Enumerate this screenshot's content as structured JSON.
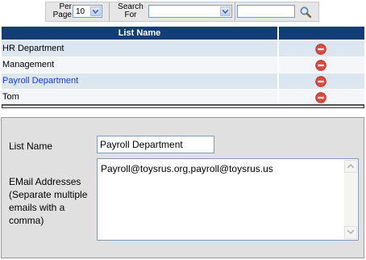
{
  "toolbar": {
    "per_page_label": "Per\nPage",
    "per_page_value": "10",
    "search_for_label": "Search\nFor",
    "search_field_value": "",
    "search_text_value": ""
  },
  "table": {
    "header": "List Name",
    "rows": [
      {
        "name": "HR Department",
        "link": false
      },
      {
        "name": "Management",
        "link": false
      },
      {
        "name": "Payroll Department",
        "link": true
      },
      {
        "name": "Tom",
        "link": false
      }
    ]
  },
  "form": {
    "list_name_label": "List Name",
    "list_name_value": "Payroll Department",
    "email_label": "EMail Addresses (Separate multiple emails with a comma)",
    "email_value": "Payroll@toysrus.org,payroll@toysrus.us"
  },
  "colors": {
    "header_bg": "#123d77",
    "row_alt": "#dce6f0",
    "row_plain": "#f4f6f9",
    "panel_bg": "#e0e0e0",
    "link": "#1a3ccc",
    "delete_icon": "#e04a3c"
  },
  "icons": {
    "search_button": "magnifier-icon",
    "delete_row": "delete-circle-icon"
  }
}
